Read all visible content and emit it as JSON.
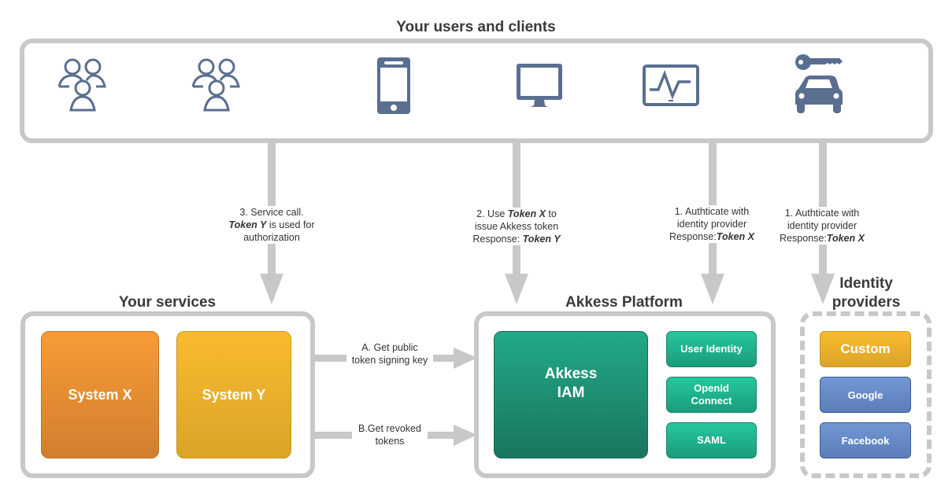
{
  "colors": {
    "icon": "#5a6f8f",
    "connector": "#c8c8c8",
    "system_x": "#f89b36",
    "system_y": "#f9bb2f",
    "akkess_iam": "#1f9a7c",
    "sub_module": "#25c79f",
    "custom_idp": "#f9bb2f",
    "social_idp": "#6a8fcc"
  },
  "clients": {
    "title": "Your users and clients",
    "icons": [
      "users-group-icon",
      "users-group-icon",
      "mobile-phone-icon",
      "desktop-monitor-icon",
      "monitoring-display-icon",
      "car-key-icon"
    ]
  },
  "flows": {
    "service_call": {
      "line1": "3. Service call.",
      "token": "Token Y",
      "line2_rest": " is used for",
      "line3": "authorization"
    },
    "use_token": {
      "prefix": "2. Use ",
      "token": "Token X",
      "suffix": " to",
      "line2": "issue Akkess token",
      "line3_prefix": "Response: ",
      "line3_token": "Token Y"
    },
    "auth_platform": {
      "line1": "1. Authticate with",
      "line2": "identity provider",
      "line3_prefix": "Response:",
      "line3_token": "Token X"
    },
    "auth_idp": {
      "line1": "1. Authticate with",
      "line2": "identity provider",
      "line3_prefix": "Response:",
      "line3_token": "Token X"
    },
    "get_key": {
      "line1": "A. Get public",
      "line2": "token signing key"
    },
    "get_revoked": {
      "line1": "B.Get revoked",
      "line2": "tokens"
    }
  },
  "services": {
    "title": "Your services",
    "systems": [
      "System X",
      "System Y"
    ]
  },
  "platform": {
    "title": "Akkess Platform",
    "core_line1": "Akkess",
    "core_line2": "IAM",
    "modules": [
      "User Identity",
      "OpenId Connect",
      "SAML"
    ]
  },
  "identity_providers": {
    "title_line1": "Identity",
    "title_line2": "providers",
    "providers": [
      "Custom",
      "Google",
      "Facebook"
    ]
  }
}
